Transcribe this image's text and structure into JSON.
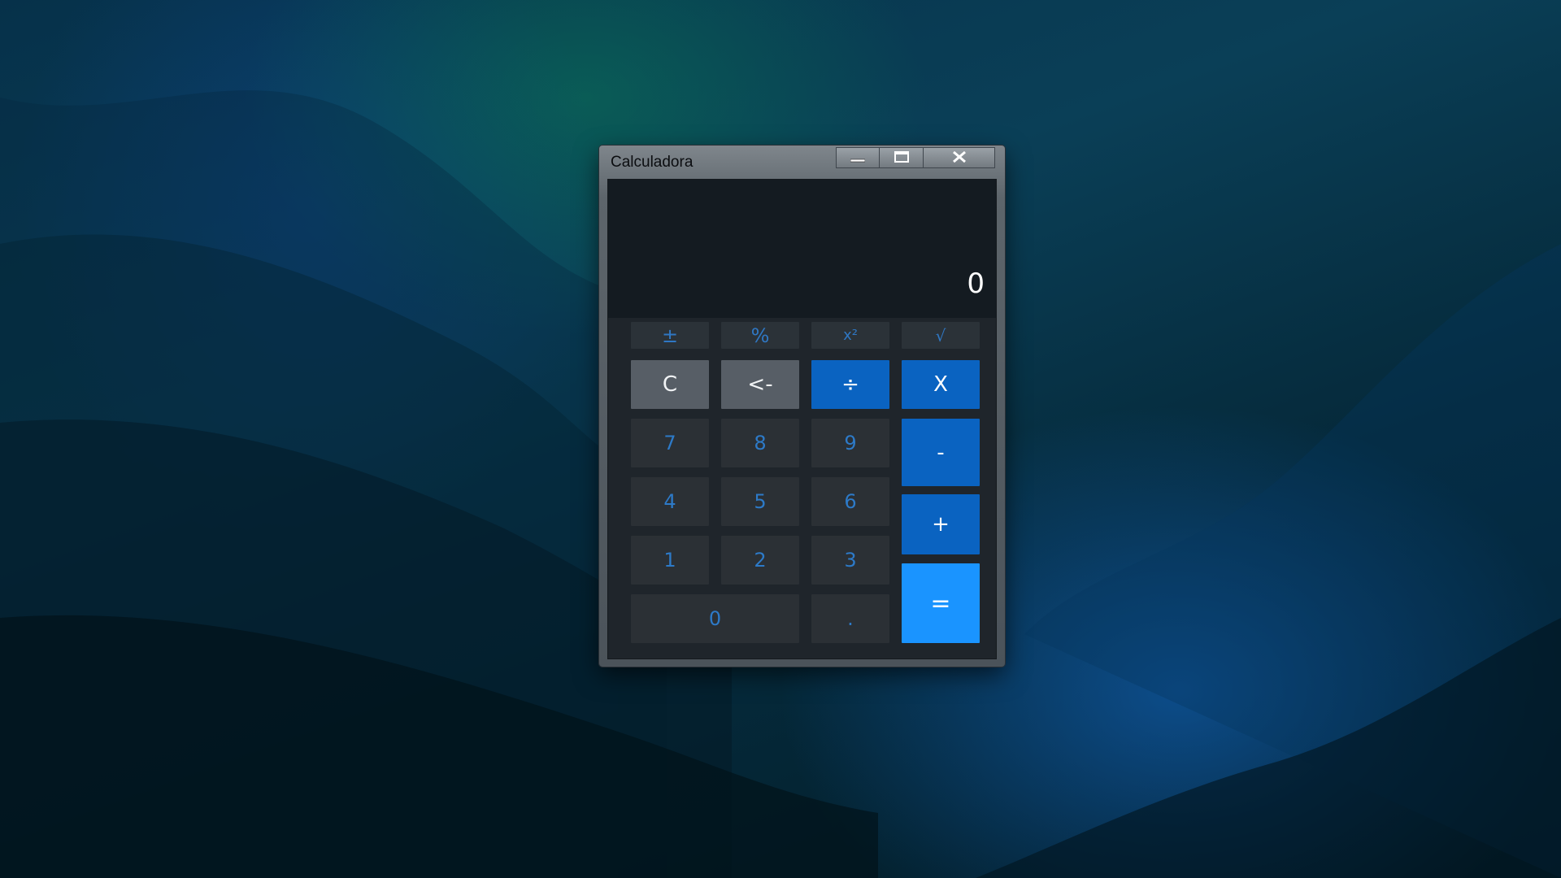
{
  "window": {
    "title": "Calculadora"
  },
  "caption_buttons": {
    "minimize": "minimize-icon",
    "maximize": "maximize-icon",
    "close": "close-icon"
  },
  "display": {
    "value": "0"
  },
  "functions": {
    "plus_minus": "±",
    "percent": "%",
    "square": "x²",
    "sqrt": "√"
  },
  "keys": {
    "clear": "C",
    "backspace": "<-",
    "divide": "÷",
    "multiply": "X",
    "subtract": "-",
    "add": "+",
    "equals": "=",
    "decimal": ".",
    "digits": {
      "d0": "0",
      "d1": "1",
      "d2": "2",
      "d3": "3",
      "d4": "4",
      "d5": "5",
      "d6": "6",
      "d7": "7",
      "d8": "8",
      "d9": "9"
    }
  },
  "colors": {
    "operator": "#0a63c1",
    "equals": "#1a94ff",
    "digit_text": "#2d7ac8",
    "display_bg": "#141b21"
  }
}
